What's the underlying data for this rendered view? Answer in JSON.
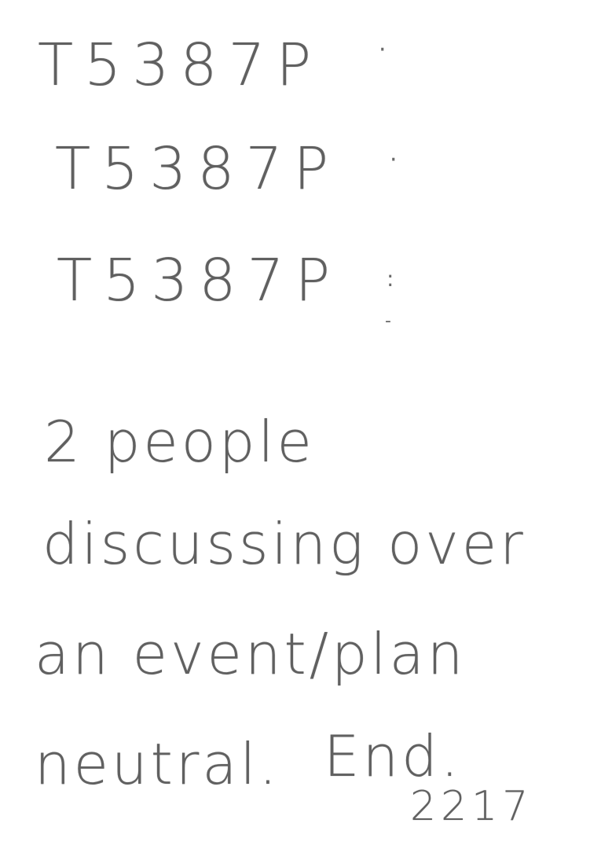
{
  "note": {
    "lines": [
      {
        "text": "T5387P"
      },
      {
        "text": "T5387P"
      },
      {
        "text": "T5387P"
      },
      {
        "text": "2 people"
      },
      {
        "text": "discussing over"
      },
      {
        "text": "an event/plan"
      },
      {
        "text": "neutral."
      },
      {
        "text": "End."
      },
      {
        "text": "2217"
      }
    ],
    "marks": [
      "·",
      "·",
      ":",
      "-"
    ]
  }
}
